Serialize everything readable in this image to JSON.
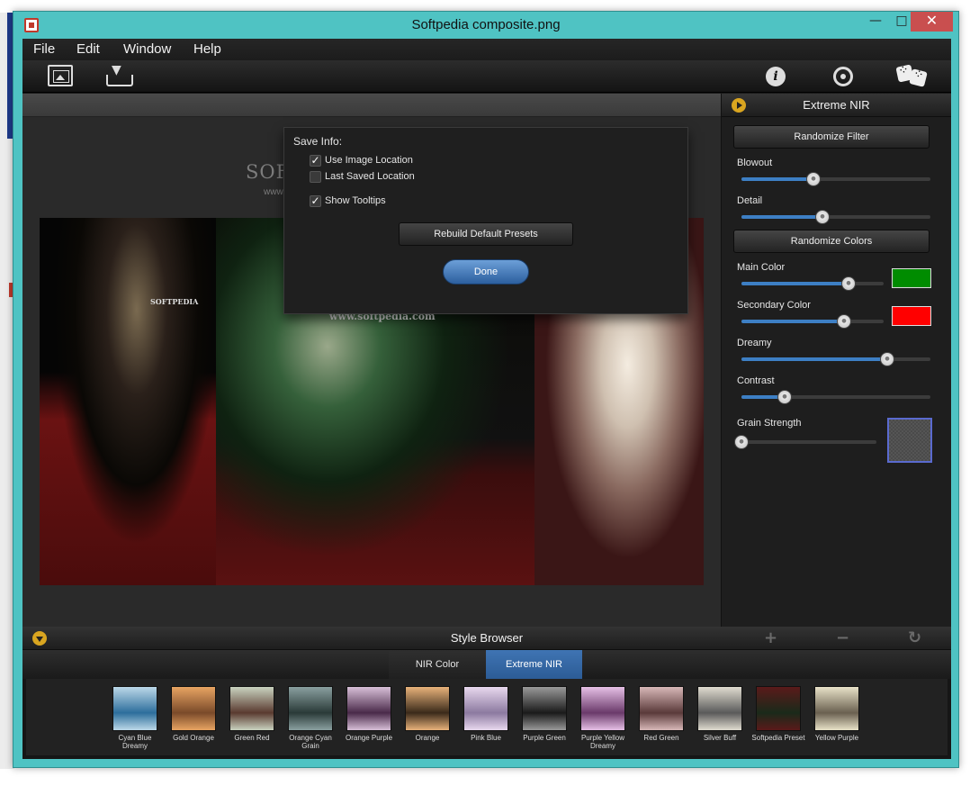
{
  "window": {
    "title": "Softpedia composite.png",
    "min_glyph": "—",
    "max_glyph": "□",
    "close_glyph": "✕"
  },
  "menu": [
    "File",
    "Edit",
    "Window",
    "Help"
  ],
  "watermark": {
    "title": "SOFTPEDIA™",
    "url": "www.softpedia.com"
  },
  "preview": {
    "url_text": "www.softpedia.com",
    "logo_text": "SOFTPEDIA"
  },
  "dialog": {
    "heading": "Save Info:",
    "options": [
      {
        "label": "Use Image Location",
        "checked": true
      },
      {
        "label": "Last Saved Location",
        "checked": false
      },
      {
        "label": "Show Tooltips",
        "checked": true
      }
    ],
    "rebuild_label": "Rebuild Default Presets",
    "done_label": "Done"
  },
  "panel": {
    "title": "Extreme NIR",
    "randomize_filter": "Randomize Filter",
    "randomize_colors": "Randomize Colors",
    "sliders": [
      {
        "label": "Blowout",
        "value": 0.38
      },
      {
        "label": "Detail",
        "value": 0.43
      },
      {
        "label": "Main Color",
        "value": 0.75,
        "color": "#008c00"
      },
      {
        "label": "Secondary Color",
        "value": 0.72,
        "color": "#ff0000"
      },
      {
        "label": "Dreamy",
        "value": 0.77
      },
      {
        "label": "Contrast",
        "value": 0.23
      },
      {
        "label": "Grain Strength",
        "value": 0.0
      }
    ]
  },
  "browser": {
    "title": "Style Browser",
    "tabs": [
      "NIR Color",
      "Extreme NIR"
    ],
    "active_tab": 1,
    "presets": [
      {
        "label": "Cyan Blue Dreamy",
        "colors": [
          "#bcd8e8",
          "#2d6e9c"
        ]
      },
      {
        "label": "Gold Orange",
        "colors": [
          "#e8a462",
          "#7a4a2a"
        ]
      },
      {
        "label": "Green Red",
        "colors": [
          "#c9d3c0",
          "#5a3a30"
        ]
      },
      {
        "label": "Orange Cyan Grain",
        "colors": [
          "#8aa0a0",
          "#2a3a38"
        ]
      },
      {
        "label": "Orange Purple",
        "colors": [
          "#d8c0d8",
          "#4a2a4a"
        ]
      },
      {
        "label": "Orange",
        "colors": [
          "#e8b27a",
          "#3a2a1a"
        ]
      },
      {
        "label": "Pink Blue",
        "colors": [
          "#e8d8ee",
          "#8c7aa0"
        ]
      },
      {
        "label": "Purple Green",
        "colors": [
          "#9a9a9a",
          "#1a1a1a"
        ]
      },
      {
        "label": "Purple Yellow Dreamy",
        "colors": [
          "#e6c0e6",
          "#6a3a6a"
        ]
      },
      {
        "label": "Red Green",
        "colors": [
          "#d8b8b8",
          "#5a3a3a"
        ]
      },
      {
        "label": "Silver Buff",
        "colors": [
          "#e0dcd0",
          "#5a5a5a"
        ]
      },
      {
        "label": "Softpedia Preset",
        "colors": [
          "#5a1a1a",
          "#1a2a1a"
        ]
      },
      {
        "label": "Yellow Purple",
        "colors": [
          "#e8e2c8",
          "#6a6050"
        ]
      }
    ]
  },
  "icons": [
    "open-image-icon",
    "save-icon",
    "info-icon",
    "settings-icon",
    "dice-icon",
    "add-icon",
    "remove-icon",
    "reset-icon"
  ]
}
